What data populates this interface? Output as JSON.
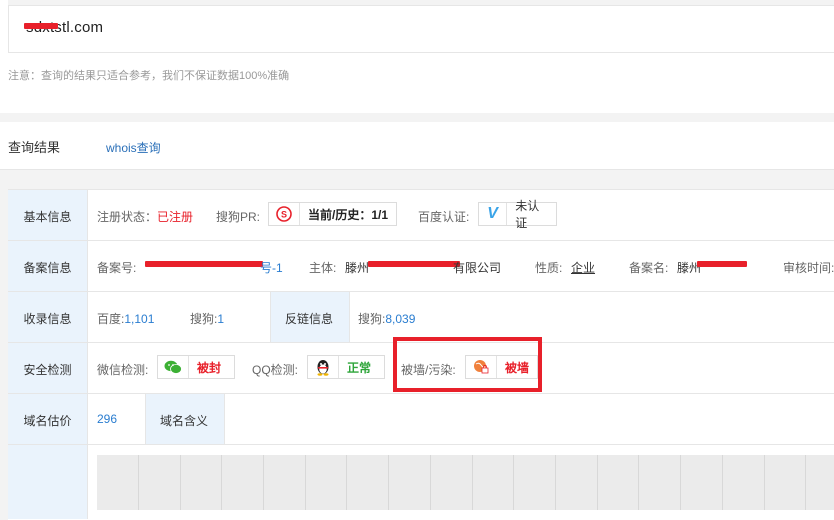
{
  "domain": {
    "visible_text": "sdxtstl.com"
  },
  "notice": "注意：查询的结果只适合参考，我们不保证数据100%准确",
  "results": {
    "title": "查询结果",
    "whois_tab": "whois查询"
  },
  "basic": {
    "label": "基本信息",
    "reg_status_key": "注册状态：",
    "reg_status_val": "已注册",
    "pr_key": "搜狗PR:",
    "pr_val_key": "当前/历史：",
    "pr_val": "1/1",
    "baidu_key": "百度认证:",
    "baidu_val": "未认证"
  },
  "icp": {
    "label": "备案信息",
    "no_key": "备案号:",
    "no_suffix": "号-1",
    "subject_key": "主体:",
    "subject_prefix": "滕州",
    "subject_suffix": "有限公司",
    "nature_key": "性质:",
    "nature_val": "企业",
    "name_key": "备案名:",
    "name_prefix": "滕州",
    "review_key": "审核时间:"
  },
  "index": {
    "label": "收录信息",
    "baidu_key": "百度:",
    "baidu_val": "1,101",
    "sogou_key": "搜狗:",
    "sogou_val": "1",
    "backlink_label": "反链信息",
    "backlink_sogou_key": "搜狗:",
    "backlink_sogou_val": "8,039"
  },
  "security": {
    "label": "安全检测",
    "wechat_key": "微信检测:",
    "wechat_val": "被封",
    "qq_key": "QQ检测:",
    "qq_val": "正常",
    "wall_key": "被墙/污染:",
    "wall_val": "被墙"
  },
  "valuation": {
    "label": "域名估价",
    "value": "296",
    "meaning_label": "域名含义"
  },
  "colors": {
    "alert_red": "#e8202a",
    "link_blue": "#2a7dd0",
    "ok_green": "#2ea53a",
    "label_bg": "#eaf3fc"
  }
}
